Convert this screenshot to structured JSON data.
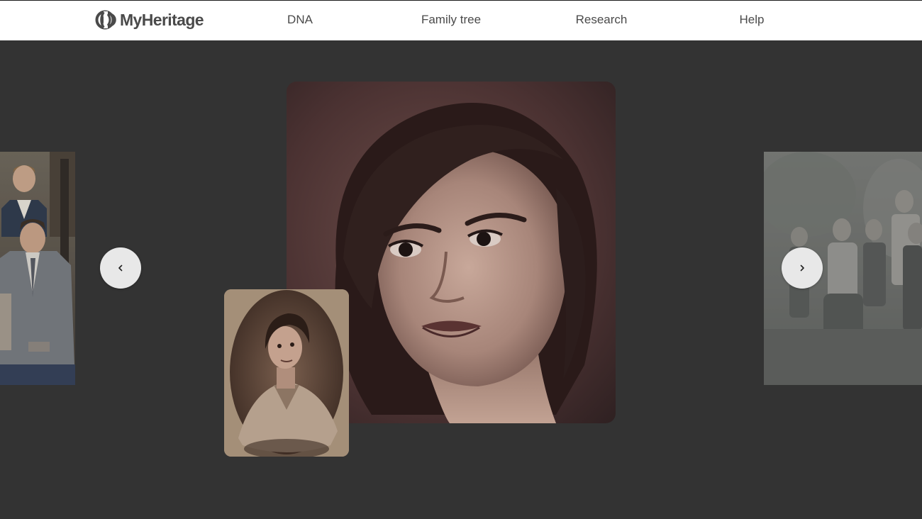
{
  "header": {
    "logo_text": "MyHeritage",
    "nav": [
      {
        "label": "DNA"
      },
      {
        "label": "Family tree"
      },
      {
        "label": "Research"
      },
      {
        "label": "Help"
      }
    ]
  },
  "carousel": {
    "icons": {
      "prev": "chevron-left-icon",
      "next": "chevron-right-icon"
    }
  },
  "colors": {
    "background": "#333333",
    "header_bg": "#ffffff",
    "nav_text": "#4a4a4a",
    "arrow_button_bg": "#e8e8e8"
  }
}
